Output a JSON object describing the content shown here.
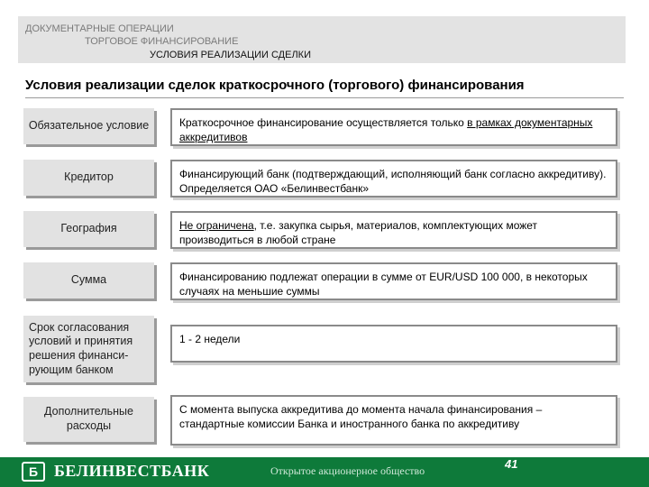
{
  "header": {
    "crumb1": "ДОКУМЕНТАРНЫЕ ОПЕРАЦИИ",
    "crumb2": "ТОРГОВОЕ ФИНАНСИРОВАНИЕ",
    "crumb3": "УСЛОВИЯ РЕАЛИЗАЦИИ СДЕЛКИ"
  },
  "title": "Условия реализации сделок краткосрочного (торгового) финансирования",
  "rows": [
    {
      "label": "Обязательное условие",
      "text_a": "Краткосрочное финансирование осуществляется только ",
      "text_u": "в рамках документарных аккредитивов",
      "text_b": ""
    },
    {
      "label": "Кредитор",
      "text_a": "Финансирующий банк (подтверждающий, исполняющий банк согласно аккредитиву). Определяется ОАО «Белинвестбанк»",
      "text_u": "",
      "text_b": ""
    },
    {
      "label": "География",
      "text_a": "",
      "text_u": "Не ограничена",
      "text_b": ", т.е. закупка сырья, материалов, комплектующих может производиться в любой стране"
    },
    {
      "label": "Сумма",
      "text_a": "Финансированию подлежат операции в сумме от EUR/USD 100 000, в некоторых случаях на меньшие суммы",
      "text_u": "",
      "text_b": ""
    },
    {
      "label": "Срок согласования условий и принятия решения финанси-рующим банком",
      "text_a": "1 - 2 недели",
      "text_u": "",
      "text_b": ""
    },
    {
      "label": "Дополнительные расходы",
      "text_a": "С момента выпуска аккредитива до момента начала финансирования – стандартные комиссии Банка и иностранного банка по аккредитиву",
      "text_u": "",
      "text_b": ""
    }
  ],
  "footer": {
    "bank_name": "БЕЛИНВЕСТБАНК",
    "org_type": "Открытое акционерное общество",
    "page_number": "41",
    "logo_icon": "belinvestbank-logo-icon"
  },
  "colors": {
    "footer_green": "#0e7a3a",
    "label_gray": "#e2e2e2"
  }
}
